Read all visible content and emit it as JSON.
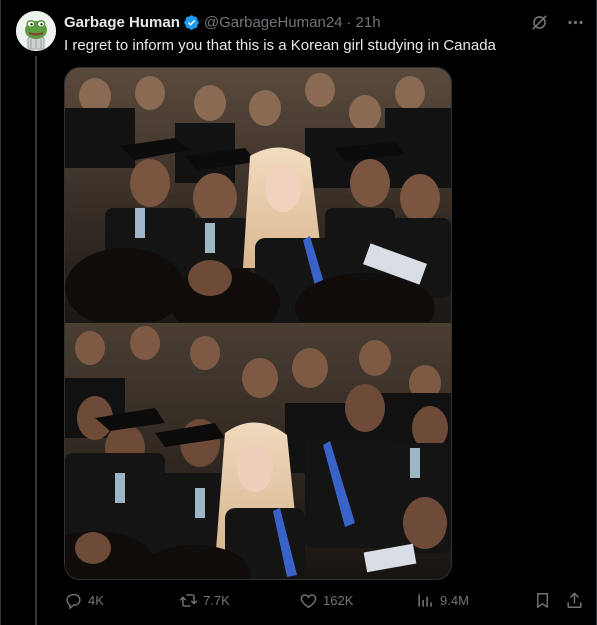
{
  "tweet": {
    "author": {
      "display_name": "Garbage Human",
      "handle": "@GarbageHuman24",
      "verified": true,
      "avatar": "pepe-frog-avatar"
    },
    "separator": "·",
    "time": "21h",
    "text": "I regret to inform you that this is a Korean girl studying in Canada",
    "media": {
      "count": 2,
      "description_icon": "photo"
    },
    "stats": {
      "replies": "4K",
      "reposts": "7.7K",
      "likes": "162K",
      "views": "9.4M"
    }
  },
  "icons": {
    "verified": "verified-badge-icon",
    "grok": "grok-icon",
    "more": "more-icon",
    "reply": "reply-icon",
    "repost": "repost-icon",
    "like": "like-icon",
    "views": "views-icon",
    "bookmark": "bookmark-icon",
    "share": "share-icon"
  },
  "colors": {
    "background": "#000000",
    "text": "#e7e9ea",
    "muted": "#71767b",
    "verified": "#1d9bf0",
    "border": "#2f3336"
  }
}
